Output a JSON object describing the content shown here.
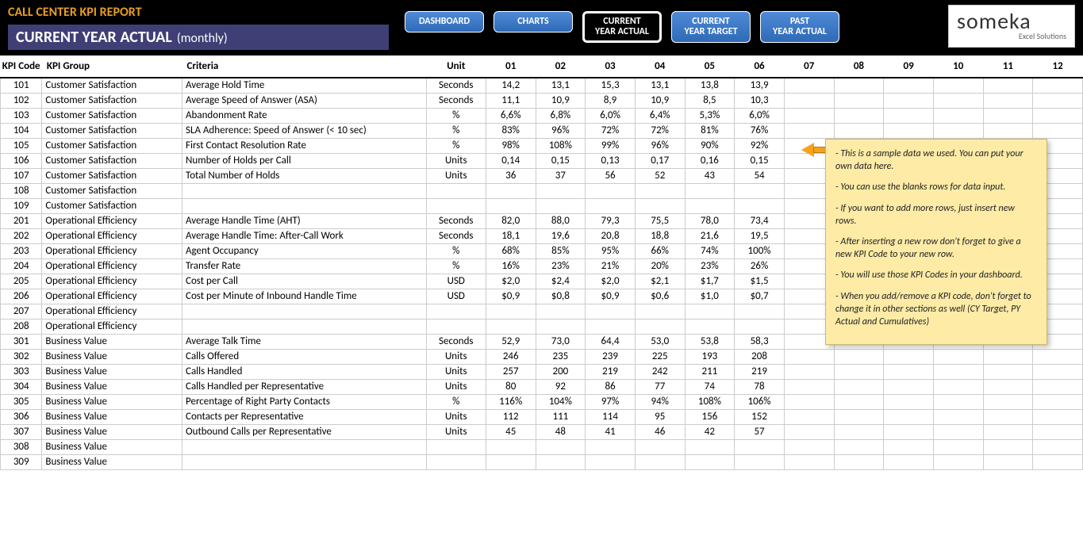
{
  "header": {
    "report_title": "CALL CENTER KPI REPORT",
    "subtitle_main": "CURRENT YEAR ACTUAL",
    "subtitle_sub": "(monthly)"
  },
  "nav": [
    {
      "label": "DASHBOARD",
      "active": false
    },
    {
      "label": "CHARTS",
      "active": false
    },
    {
      "label": "CURRENT YEAR ACTUAL",
      "active": true
    },
    {
      "label": "CURRENT YEAR TARGET",
      "active": false
    },
    {
      "label": "PAST YEAR ACTUAL",
      "active": false
    }
  ],
  "logo": {
    "main": "someka",
    "sub": "Excel Solutions"
  },
  "columns": {
    "code": "KPI Code",
    "group": "KPI Group",
    "criteria": "Criteria",
    "unit": "Unit",
    "months": [
      "01",
      "02",
      "03",
      "04",
      "05",
      "06",
      "07",
      "08",
      "09",
      "10",
      "11",
      "12"
    ]
  },
  "rows": [
    {
      "code": "101",
      "group": "Customer Satisfaction",
      "criteria": "Average Hold Time",
      "unit": "Seconds",
      "v": [
        "14,2",
        "13,1",
        "15,3",
        "13,1",
        "13,8",
        "13,9",
        "",
        "",
        "",
        "",
        "",
        ""
      ]
    },
    {
      "code": "102",
      "group": "Customer Satisfaction",
      "criteria": "Average Speed of Answer (ASA)",
      "unit": "Seconds",
      "v": [
        "11,1",
        "10,9",
        "8,9",
        "10,9",
        "8,5",
        "10,3",
        "",
        "",
        "",
        "",
        "",
        ""
      ]
    },
    {
      "code": "103",
      "group": "Customer Satisfaction",
      "criteria": "Abandonment Rate",
      "unit": "%",
      "v": [
        "6,6%",
        "6,8%",
        "6,0%",
        "6,4%",
        "5,3%",
        "6,0%",
        "",
        "",
        "",
        "",
        "",
        ""
      ]
    },
    {
      "code": "104",
      "group": "Customer Satisfaction",
      "criteria": "SLA Adherence: Speed of Answer (< 10 sec)",
      "unit": "%",
      "v": [
        "83%",
        "96%",
        "72%",
        "72%",
        "81%",
        "76%",
        "",
        "",
        "",
        "",
        "",
        ""
      ]
    },
    {
      "code": "105",
      "group": "Customer Satisfaction",
      "criteria": "First Contact Resolution Rate",
      "unit": "%",
      "v": [
        "98%",
        "108%",
        "99%",
        "96%",
        "90%",
        "92%",
        "",
        "",
        "",
        "",
        "",
        ""
      ]
    },
    {
      "code": "106",
      "group": "Customer Satisfaction",
      "criteria": "Number of Holds per Call",
      "unit": "Units",
      "v": [
        "0,14",
        "0,15",
        "0,13",
        "0,17",
        "0,16",
        "0,15",
        "",
        "",
        "",
        "",
        "",
        ""
      ]
    },
    {
      "code": "107",
      "group": "Customer Satisfaction",
      "criteria": "Total Number of Holds",
      "unit": "Units",
      "v": [
        "36",
        "37",
        "56",
        "52",
        "43",
        "54",
        "",
        "",
        "",
        "",
        "",
        ""
      ]
    },
    {
      "code": "108",
      "group": "Customer Satisfaction",
      "criteria": "",
      "unit": "",
      "v": [
        "",
        "",
        "",
        "",
        "",
        "",
        "",
        "",
        "",
        "",
        "",
        ""
      ]
    },
    {
      "code": "109",
      "group": "Customer Satisfaction",
      "criteria": "",
      "unit": "",
      "v": [
        "",
        "",
        "",
        "",
        "",
        "",
        "",
        "",
        "",
        "",
        "",
        ""
      ]
    },
    {
      "code": "201",
      "group": "Operational Efficiency",
      "criteria": "Average Handle Time (AHT)",
      "unit": "Seconds",
      "v": [
        "82,0",
        "88,0",
        "79,3",
        "75,5",
        "78,0",
        "73,4",
        "",
        "",
        "",
        "",
        "",
        ""
      ]
    },
    {
      "code": "202",
      "group": "Operational Efficiency",
      "criteria": "Average Handle Time: After-Call Work",
      "unit": "Seconds",
      "v": [
        "18,1",
        "19,6",
        "20,8",
        "18,8",
        "21,6",
        "19,5",
        "",
        "",
        "",
        "",
        "",
        ""
      ]
    },
    {
      "code": "203",
      "group": "Operational Efficiency",
      "criteria": "Agent Occupancy",
      "unit": "%",
      "v": [
        "68%",
        "85%",
        "95%",
        "66%",
        "74%",
        "100%",
        "",
        "",
        "",
        "",
        "",
        ""
      ]
    },
    {
      "code": "204",
      "group": "Operational Efficiency",
      "criteria": "Transfer Rate",
      "unit": "%",
      "v": [
        "16%",
        "23%",
        "21%",
        "20%",
        "23%",
        "26%",
        "",
        "",
        "",
        "",
        "",
        ""
      ]
    },
    {
      "code": "205",
      "group": "Operational Efficiency",
      "criteria": "Cost per Call",
      "unit": "USD",
      "v": [
        "$2,0",
        "$2,4",
        "$2,0",
        "$2,1",
        "$1,7",
        "$1,5",
        "",
        "",
        "",
        "",
        "",
        ""
      ]
    },
    {
      "code": "206",
      "group": "Operational Efficiency",
      "criteria": "Cost per Minute of Inbound Handle Time",
      "unit": "USD",
      "v": [
        "$0,9",
        "$0,8",
        "$0,9",
        "$0,6",
        "$1,0",
        "$0,7",
        "",
        "",
        "",
        "",
        "",
        ""
      ]
    },
    {
      "code": "207",
      "group": "Operational Efficiency",
      "criteria": "",
      "unit": "",
      "v": [
        "",
        "",
        "",
        "",
        "",
        "",
        "",
        "",
        "",
        "",
        "",
        ""
      ]
    },
    {
      "code": "208",
      "group": "Operational Efficiency",
      "criteria": "",
      "unit": "",
      "v": [
        "",
        "",
        "",
        "",
        "",
        "",
        "",
        "",
        "",
        "",
        "",
        ""
      ]
    },
    {
      "code": "301",
      "group": "Business Value",
      "criteria": "Average Talk Time",
      "unit": "Seconds",
      "v": [
        "52,9",
        "73,0",
        "64,4",
        "53,0",
        "53,8",
        "58,3",
        "",
        "",
        "",
        "",
        "",
        ""
      ]
    },
    {
      "code": "302",
      "group": "Business Value",
      "criteria": "Calls Offered",
      "unit": "Units",
      "v": [
        "246",
        "235",
        "239",
        "225",
        "193",
        "208",
        "",
        "",
        "",
        "",
        "",
        ""
      ]
    },
    {
      "code": "303",
      "group": "Business Value",
      "criteria": "Calls Handled",
      "unit": "Units",
      "v": [
        "257",
        "200",
        "219",
        "242",
        "211",
        "219",
        "",
        "",
        "",
        "",
        "",
        ""
      ]
    },
    {
      "code": "304",
      "group": "Business Value",
      "criteria": "Calls Handled per Representative",
      "unit": "Units",
      "v": [
        "80",
        "92",
        "86",
        "77",
        "74",
        "78",
        "",
        "",
        "",
        "",
        "",
        ""
      ]
    },
    {
      "code": "305",
      "group": "Business Value",
      "criteria": "Percentage of Right Party Contacts",
      "unit": "%",
      "v": [
        "116%",
        "104%",
        "97%",
        "94%",
        "108%",
        "106%",
        "",
        "",
        "",
        "",
        "",
        ""
      ]
    },
    {
      "code": "306",
      "group": "Business Value",
      "criteria": "Contacts per Representative",
      "unit": "Units",
      "v": [
        "112",
        "111",
        "114",
        "95",
        "156",
        "152",
        "",
        "",
        "",
        "",
        "",
        ""
      ]
    },
    {
      "code": "307",
      "group": "Business Value",
      "criteria": "Outbound Calls per Representative",
      "unit": "Units",
      "v": [
        "45",
        "48",
        "41",
        "46",
        "42",
        "57",
        "",
        "",
        "",
        "",
        "",
        ""
      ]
    },
    {
      "code": "308",
      "group": "Business Value",
      "criteria": "",
      "unit": "",
      "v": [
        "",
        "",
        "",
        "",
        "",
        "",
        "",
        "",
        "",
        "",
        "",
        ""
      ]
    },
    {
      "code": "309",
      "group": "Business Value",
      "criteria": "",
      "unit": "",
      "v": [
        "",
        "",
        "",
        "",
        "",
        "",
        "",
        "",
        "",
        "",
        "",
        ""
      ]
    }
  ],
  "callout": [
    "- This is a sample data we used. You can put your own data here.",
    "- You can use the blanks rows for data input.",
    "- If you want to add more rows, just insert new rows.",
    "- After inserting a new row don't forget to give a new KPI Code to your new row.",
    "- You will use those KPI Codes in your dashboard.",
    "- When you add/remove a KPI code, don't forget to change it in other sections as well (CY Target, PY Actual and Cumulatives)"
  ]
}
